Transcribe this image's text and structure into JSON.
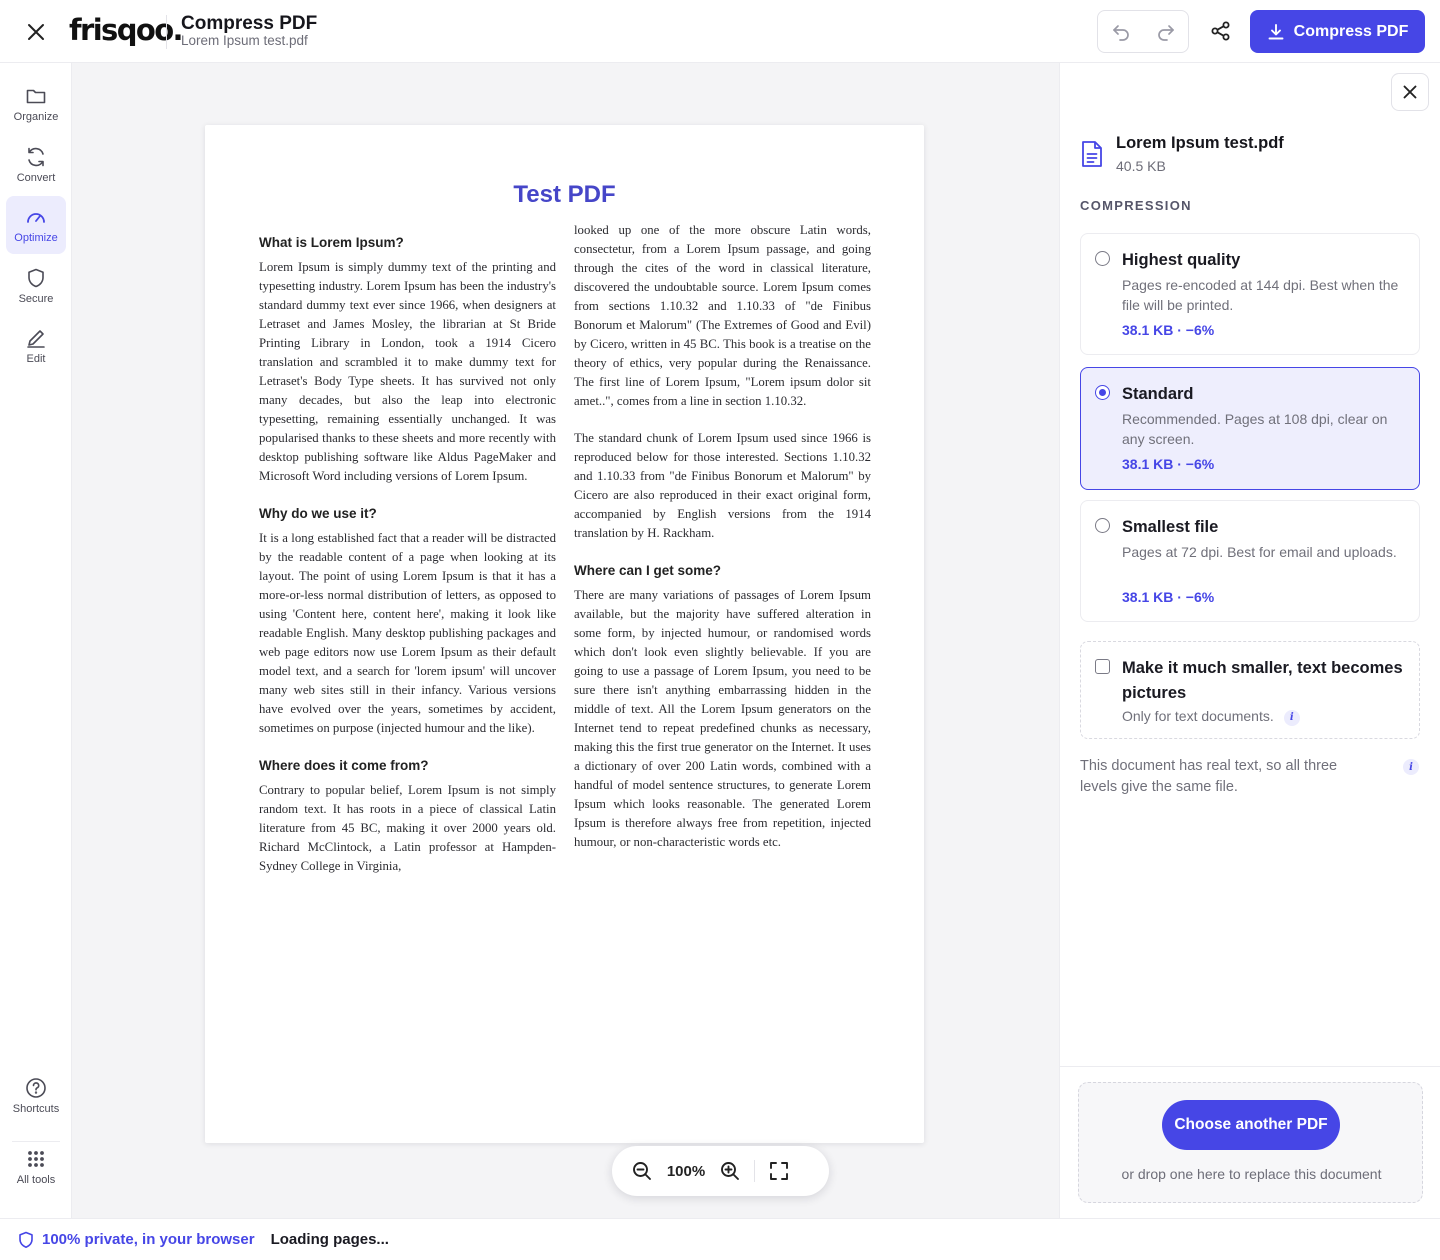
{
  "header": {
    "logo": "frisqoo.",
    "title": "Compress PDF",
    "filename": "Lorem Ipsum test.pdf",
    "primary_action": "Compress PDF"
  },
  "rail": {
    "items": [
      {
        "label": "Organize",
        "icon": "folder-icon"
      },
      {
        "label": "Convert",
        "icon": "refresh-icon"
      },
      {
        "label": "Optimize",
        "icon": "gauge-icon",
        "active": true
      },
      {
        "label": "Secure",
        "icon": "shield-icon"
      },
      {
        "label": "Edit",
        "icon": "pencil-icon"
      }
    ],
    "bottom": [
      {
        "label": "Shortcuts",
        "icon": "help-circle-icon"
      },
      {
        "label": "All tools",
        "icon": "grid-dots-icon"
      }
    ]
  },
  "document": {
    "title": "Test PDF",
    "left_column": [
      {
        "heading": "What is Lorem Ipsum?",
        "text": "Lorem Ipsum is simply dummy text of the printing and typesetting industry. Lorem Ipsum has been the industry's standard dummy text ever since 1966, when designers at Letraset and James Mosley, the librarian at St Bride Printing Library in London, took a 1914 Cicero translation and scrambled it to make dummy text for Letraset's Body Type sheets. It has survived not only many decades, but also the leap into electronic typesetting, remaining essentially unchanged. It was popularised thanks to these sheets and more recently with desktop publishing software like Aldus PageMaker and Microsoft Word including versions of Lorem Ipsum."
      },
      {
        "heading": "Why do we use it?",
        "text": "It is a long established fact that a reader will be distracted by the readable content of a page when looking at its layout. The point of using Lorem Ipsum is that it has a more-or-less normal distribution of letters, as opposed to using 'Content here, content here', making it look like readable English. Many desktop publishing packages and web page editors now use Lorem Ipsum as their default model text, and a search for 'lorem ipsum' will uncover many web sites still in their infancy. Various versions have evolved over the years, sometimes by accident, sometimes on purpose (injected humour and the like)."
      },
      {
        "heading": "Where does it come from?",
        "text": "Contrary to popular belief, Lorem Ipsum is not simply random text. It has roots in a piece of classical Latin literature from 45 BC, making it over 2000 years old. Richard McClintock, a Latin professor at Hampden-Sydney College in Virginia,"
      }
    ],
    "right_column": [
      {
        "heading": "",
        "text": "looked up one of the more obscure Latin words, consectetur, from a Lorem Ipsum passage, and going through the cites of the word in classical literature, discovered the undoubtable source. Lorem Ipsum comes from sections 1.10.32 and 1.10.33 of \"de Finibus Bonorum et Malorum\" (The Extremes of Good and Evil) by Cicero, written in 45 BC. This book is a treatise on the theory of ethics, very popular during the Renaissance. The first line of Lorem Ipsum, \"Lorem ipsum dolor sit amet..\", comes from a line in section 1.10.32."
      },
      {
        "heading": "",
        "text": "The standard chunk of Lorem Ipsum used since 1966 is reproduced below for those interested. Sections 1.10.32 and 1.10.33 from \"de Finibus Bonorum et Malorum\" by Cicero are also reproduced in their exact original form, accompanied by English versions from the 1914 translation by H. Rackham."
      },
      {
        "heading": "Where can I get some?",
        "text": "There are many variations of passages of Lorem Ipsum available, but the majority have suffered alteration in some form, by injected humour, or randomised words which don't look even slightly believable. If you are going to use a passage of Lorem Ipsum, you need to be sure there isn't anything embarrassing hidden in the middle of text. All the Lorem Ipsum generators on the Internet tend to repeat predefined chunks as necessary, making this the first true generator on the Internet. It uses a dictionary of over 200 Latin words, combined with a handful of model sentence structures, to generate Lorem Ipsum which looks reasonable. The generated Lorem Ipsum is therefore always free from repetition, injected humour, or non-characteristic words etc."
      }
    ]
  },
  "zoom": {
    "value": "100%"
  },
  "panel": {
    "file_name": "Lorem Ipsum test.pdf",
    "file_size": "40.5 KB",
    "section_label": "COMPRESSION",
    "options": [
      {
        "title": "Highest quality",
        "desc": "Pages re-encoded at 144 dpi. Best when the file will be printed.",
        "size": "38.1 KB · −6%",
        "selected": false
      },
      {
        "title": "Standard",
        "desc": "Recommended. Pages at 108 dpi, clear on any screen.",
        "size": "38.1 KB · −6%",
        "selected": true
      },
      {
        "title": "Smallest file",
        "desc": "Pages at 72 dpi. Best for email and uploads.",
        "size": "38.1 KB · −6%",
        "selected": false
      }
    ],
    "rasterize": {
      "title": "Make it much smaller, text becomes pictures",
      "desc": "Only for text documents.",
      "checked": false
    },
    "note": "This document has real text, so all three levels give the same file.",
    "info_glyph": "i",
    "choose_button": "Choose another PDF",
    "drop_hint": "or drop one here to replace this document"
  },
  "status": {
    "privacy": "100% private, in your browser",
    "loading": "Loading pages..."
  },
  "colors": {
    "accent": "#4646e6",
    "accent_soft": "#eeeefd",
    "pdf_title": "#4646c8"
  }
}
